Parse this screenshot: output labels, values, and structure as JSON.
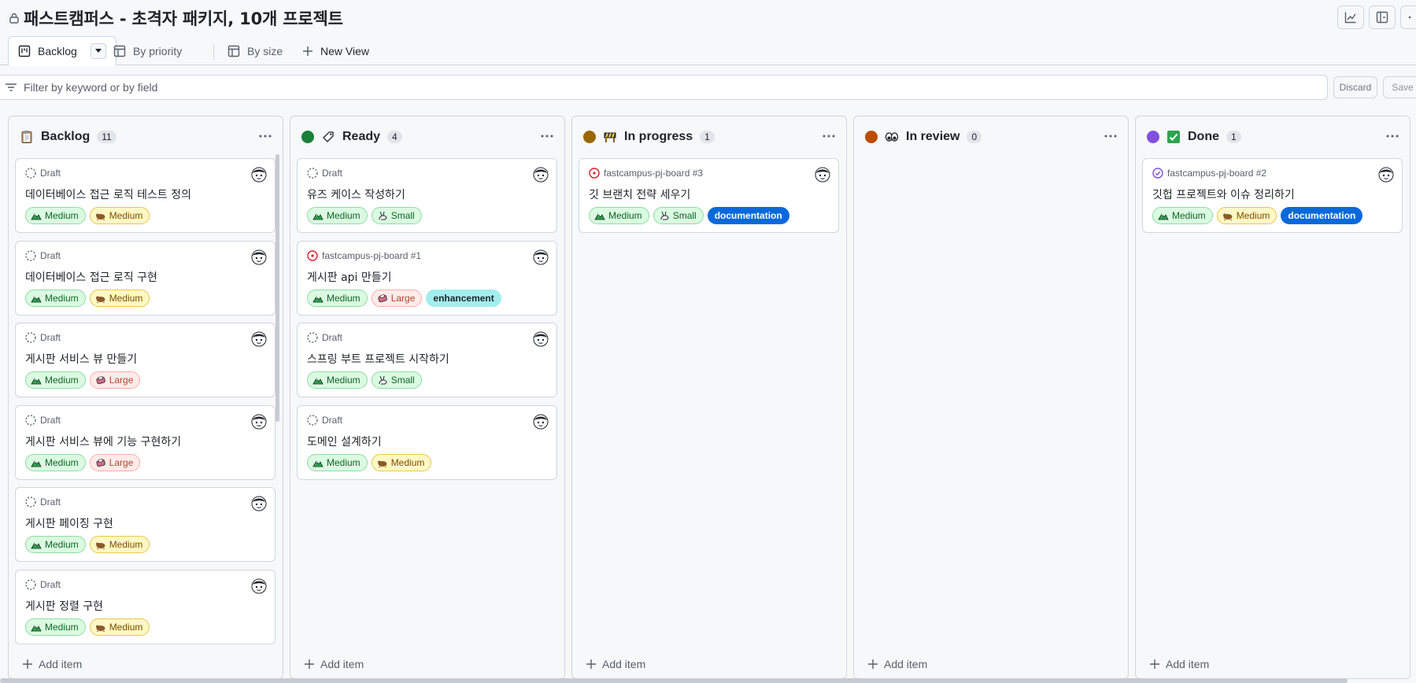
{
  "project": {
    "title": "패스트캠퍼스 - 초격자 패키지, 10개 프로젝트"
  },
  "tabs": [
    {
      "label": "Backlog",
      "active": true,
      "icon": "board-icon"
    },
    {
      "label": "By priority",
      "icon": "table-icon"
    },
    {
      "label": "By size",
      "icon": "table-icon"
    },
    {
      "label": "New View",
      "icon": "plus-icon"
    }
  ],
  "filter": {
    "placeholder": "Filter by keyword or by field",
    "discard_label": "Discard",
    "save_label": "Save"
  },
  "colors": {
    "ready": "#1a7f37",
    "in_progress": "#9a6700",
    "in_review": "#bc4c00",
    "done": "#8250df",
    "documentation": "#0969da",
    "enhancement": "#a2eeef"
  },
  "columns": [
    {
      "title": "Backlog",
      "count": "11",
      "add_label": "Add item",
      "cards": [
        {
          "meta": "Draft",
          "title": "데이터베이스 접근 로직 테스트 정의",
          "labels": [
            {
              "text": "Medium",
              "kind": "green"
            },
            {
              "text": "Medium",
              "kind": "yellow"
            }
          ]
        },
        {
          "meta": "Draft",
          "title": "데이터베이스 접근 로직 구현",
          "labels": [
            {
              "text": "Medium",
              "kind": "green"
            },
            {
              "text": "Medium",
              "kind": "yellow"
            }
          ]
        },
        {
          "meta": "Draft",
          "title": "게시판 서비스 뷰 만들기",
          "labels": [
            {
              "text": "Medium",
              "kind": "green"
            },
            {
              "text": "Large",
              "kind": "red"
            }
          ]
        },
        {
          "meta": "Draft",
          "title": "게시판 서비스 뷰에 기능 구현하기",
          "labels": [
            {
              "text": "Medium",
              "kind": "green"
            },
            {
              "text": "Large",
              "kind": "red"
            }
          ]
        },
        {
          "meta": "Draft",
          "title": "게시판 페이징 구현",
          "labels": [
            {
              "text": "Medium",
              "kind": "green"
            },
            {
              "text": "Medium",
              "kind": "yellow"
            }
          ]
        },
        {
          "meta": "Draft",
          "title": "게시판 정렬 구현",
          "labels": [
            {
              "text": "Medium",
              "kind": "green"
            },
            {
              "text": "Medium",
              "kind": "yellow"
            }
          ]
        }
      ]
    },
    {
      "title": "Ready",
      "count": "4",
      "add_label": "Add item",
      "cards": [
        {
          "meta": "Draft",
          "title": "유즈 케이스 작성하기",
          "labels": [
            {
              "text": "Medium",
              "kind": "green"
            },
            {
              "text": "Small",
              "kind": "green"
            }
          ]
        },
        {
          "meta": "fastcampus-pj-board #1",
          "title": "게시판 api 만들기",
          "labels": [
            {
              "text": "Medium",
              "kind": "green"
            },
            {
              "text": "Large",
              "kind": "red"
            },
            {
              "text": "enhancement",
              "kind": "enh"
            }
          ]
        },
        {
          "meta": "Draft",
          "title": "스프링 부트 프로젝트 시작하기",
          "labels": [
            {
              "text": "Medium",
              "kind": "green"
            },
            {
              "text": "Small",
              "kind": "green"
            }
          ]
        },
        {
          "meta": "Draft",
          "title": "도메인 설계하기",
          "labels": [
            {
              "text": "Medium",
              "kind": "green"
            },
            {
              "text": "Medium",
              "kind": "yellow"
            }
          ]
        }
      ]
    },
    {
      "title": "In progress",
      "count": "1",
      "add_label": "Add item",
      "cards": [
        {
          "meta": "fastcampus-pj-board #3",
          "title": "깃 브랜치 전략 세우기",
          "labels": [
            {
              "text": "Medium",
              "kind": "green"
            },
            {
              "text": "Small",
              "kind": "green"
            },
            {
              "text": "documentation",
              "kind": "doc"
            }
          ]
        }
      ]
    },
    {
      "title": "In review",
      "count": "0",
      "add_label": "Add item",
      "cards": []
    },
    {
      "title": "Done",
      "count": "1",
      "add_label": "Add item",
      "cards": [
        {
          "meta": "fastcampus-pj-board #2",
          "title": "깃헙 프로젝트와 이슈 정리하기",
          "labels": [
            {
              "text": "Medium",
              "kind": "green"
            },
            {
              "text": "Medium",
              "kind": "yellow"
            },
            {
              "text": "documentation",
              "kind": "doc"
            }
          ]
        }
      ]
    }
  ]
}
